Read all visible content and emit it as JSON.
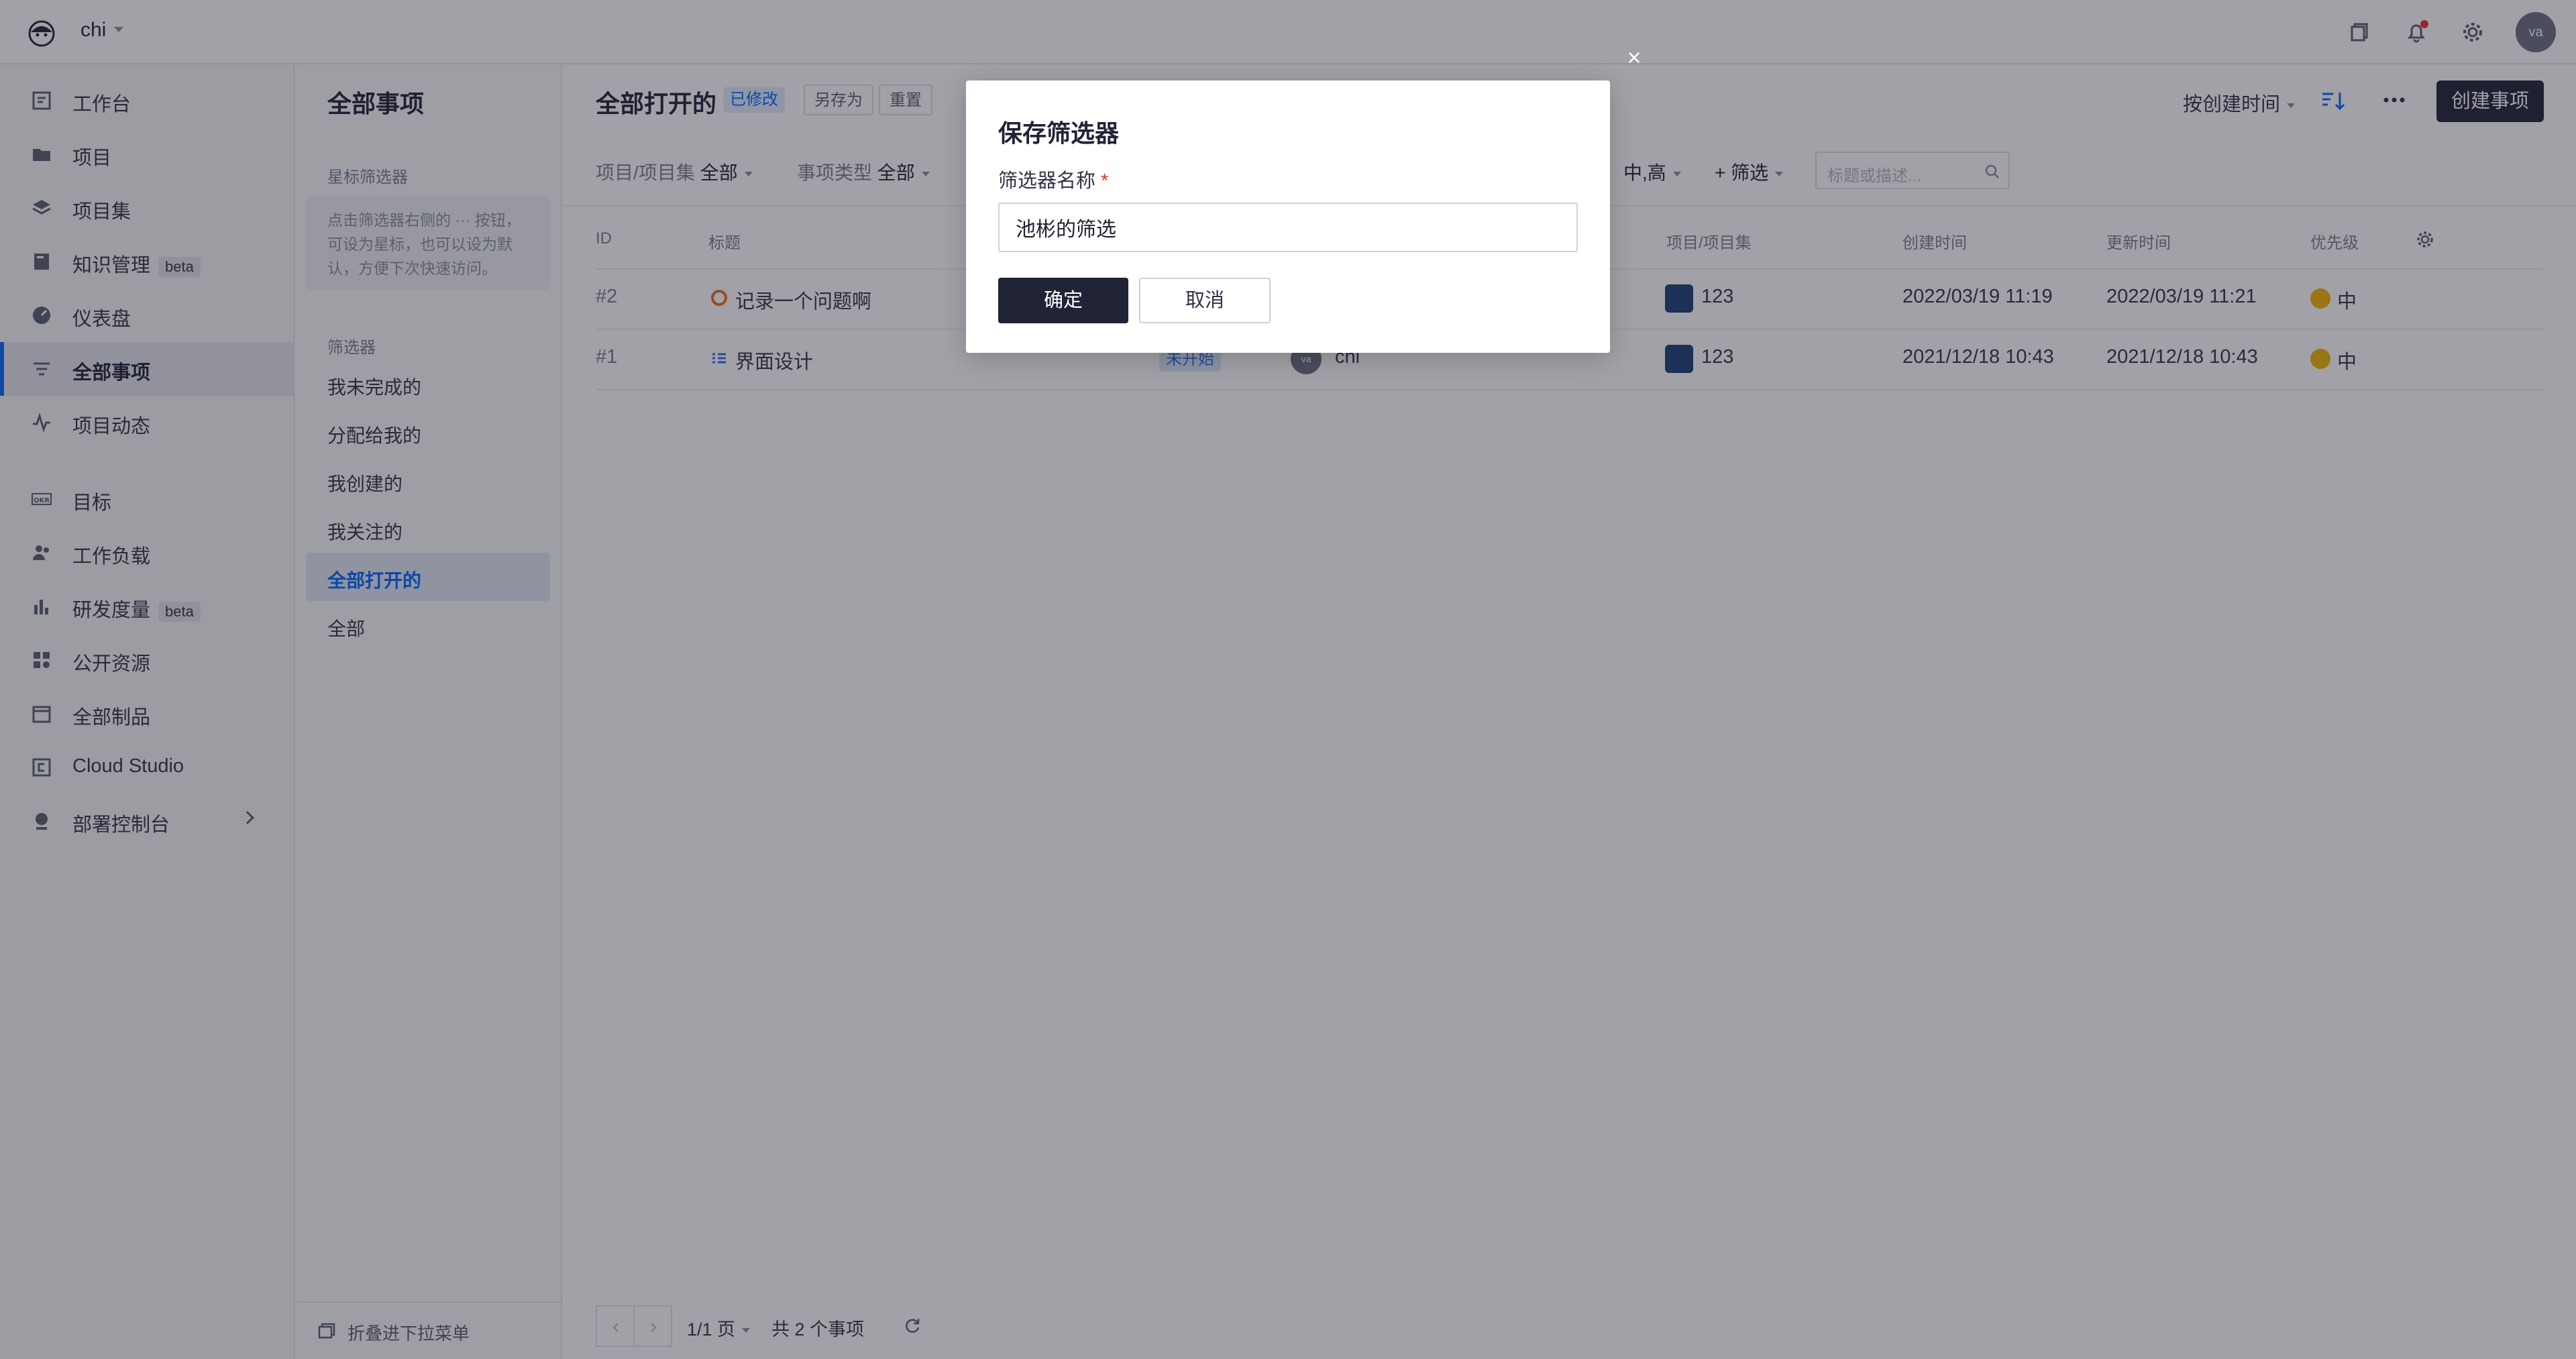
{
  "topbar": {
    "team_name": "chi",
    "avatar_initials": "va"
  },
  "leftnav": {
    "items": [
      {
        "label": "工作台",
        "icon": "workbench-icon"
      },
      {
        "label": "项目",
        "icon": "folder-icon"
      },
      {
        "label": "项目集",
        "icon": "layers-icon"
      },
      {
        "label": "知识管理",
        "icon": "book-icon",
        "badge": "beta"
      },
      {
        "label": "仪表盘",
        "icon": "dashboard-icon"
      },
      {
        "label": "全部事项",
        "icon": "filter-list-icon",
        "active": true
      },
      {
        "label": "项目动态",
        "icon": "activity-icon"
      },
      {
        "label": "目标",
        "icon": "okr-icon"
      },
      {
        "label": "工作负载",
        "icon": "users-icon"
      },
      {
        "label": "研发度量",
        "icon": "bar-chart-icon",
        "badge": "beta"
      },
      {
        "label": "公开资源",
        "icon": "grid-icon"
      },
      {
        "label": "全部制品",
        "icon": "package-icon"
      },
      {
        "label": "Cloud Studio",
        "icon": "cloud-studio-icon"
      },
      {
        "label": "部署控制台",
        "icon": "deploy-icon"
      }
    ]
  },
  "filtercol": {
    "title": "全部事项",
    "starred_section": "星标筛选器",
    "hint": "点击筛选器右侧的 ··· 按钮，可设为星标，也可以设为默认，方便下次快速访问。",
    "filters_section": "筛选器",
    "filters": [
      "我未完成的",
      "分配给我的",
      "我创建的",
      "我关注的",
      "全部打开的",
      "全部"
    ],
    "active_filter": "全部打开的",
    "collapse_label": "折叠进下拉菜单"
  },
  "main": {
    "title": "全部打开的",
    "modified_tag": "已修改",
    "save_as": "另存为",
    "reset": "重置",
    "sort_label": "按创建时间",
    "create_button": "创建事项",
    "filter_project_label": "项目/项目集",
    "filter_project_value": "全部",
    "filter_type_label": "事项类型",
    "filter_type_value": "全部",
    "filter_priority_value": "中,高",
    "add_filter": "+ 筛选",
    "search_placeholder": "标题或描述..."
  },
  "table": {
    "columns": [
      "ID",
      "标题",
      "项目/项目集",
      "创建时间",
      "更新时间",
      "优先级"
    ],
    "rows": [
      {
        "id": "#2",
        "title": "记录一个问题啊",
        "project": "123",
        "created": "2022/03/19 11:19",
        "updated": "2022/03/19 11:21",
        "priority": "中"
      },
      {
        "id": "#1",
        "title": "界面设计",
        "status": "未开始",
        "assignee": "chi",
        "assignee_avatar": "va",
        "project": "123",
        "created": "2021/12/18 10:43",
        "updated": "2021/12/18 10:43",
        "priority": "中"
      }
    ]
  },
  "pager": {
    "page": "1/1 页",
    "total": "共 2 个事项"
  },
  "modal": {
    "title": "保存筛选器",
    "field_label": "筛选器名称",
    "required_mark": "*",
    "input_value": "池彬的筛选",
    "ok": "确定",
    "cancel": "取消",
    "close": "×"
  }
}
